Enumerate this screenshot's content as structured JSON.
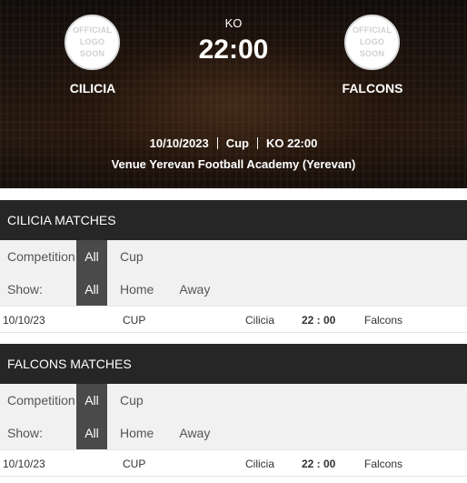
{
  "fixture": {
    "home": {
      "name": "CILICIA",
      "logo_text": "OFFICIAL\nLOGO\nSOON"
    },
    "away": {
      "name": "FALCONS",
      "logo_text": "OFFICIAL\nLOGO\nSOON"
    },
    "ko_label": "KO",
    "ko_time": "22:00",
    "date": "10/10/2023",
    "competition": "Cup",
    "ko_info": "KO 22:00",
    "venue": "Venue Yerevan Football Academy (Yerevan)"
  },
  "sections": [
    {
      "title": "CILICIA MATCHES",
      "competition_label": "Competition:",
      "competition_options": [
        "All",
        "Cup"
      ],
      "show_label": "Show:",
      "show_options": [
        "All",
        "Home",
        "Away"
      ],
      "matches": [
        {
          "date": "10/10/23",
          "competition": "CUP",
          "home": "Cilicia",
          "score": "22 : 00",
          "away": "Falcons"
        }
      ]
    },
    {
      "title": "FALCONS MATCHES",
      "competition_label": "Competition:",
      "competition_options": [
        "All",
        "Cup"
      ],
      "show_label": "Show:",
      "show_options": [
        "All",
        "Home",
        "Away"
      ],
      "matches": [
        {
          "date": "10/10/23",
          "competition": "CUP",
          "home": "Cilicia",
          "score": "22 : 00",
          "away": "Falcons"
        }
      ]
    }
  ]
}
